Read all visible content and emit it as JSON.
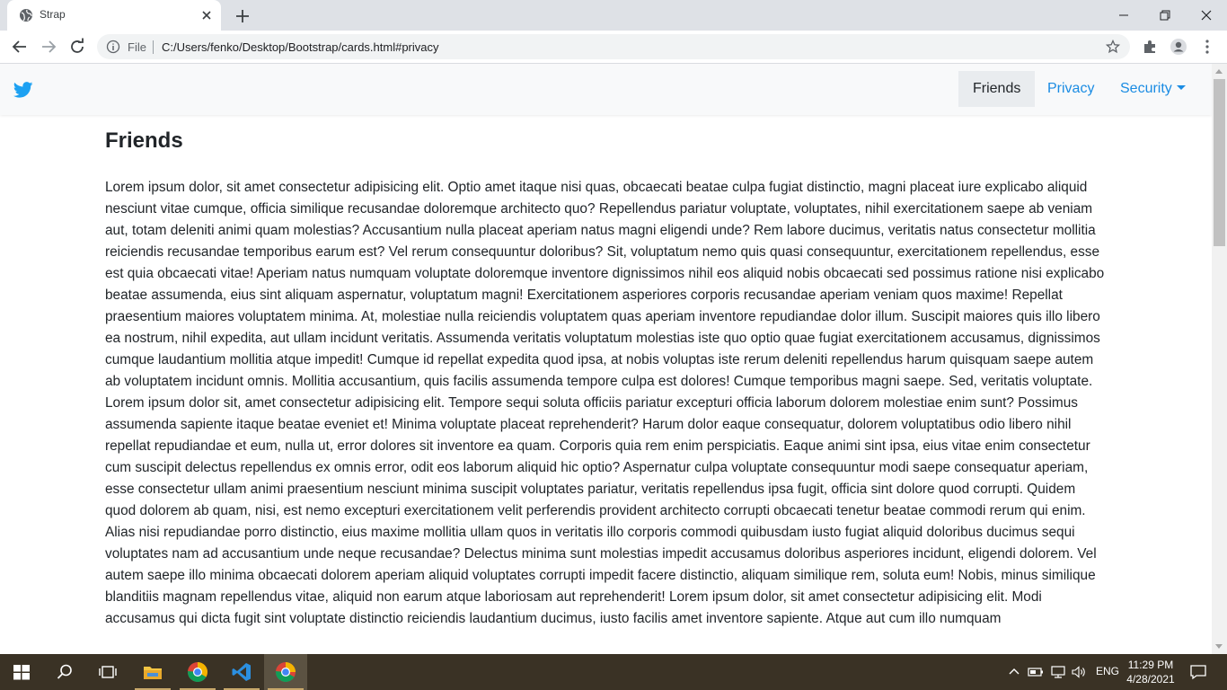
{
  "browser": {
    "tab_title": "Strap",
    "address_scheme": "File",
    "address_url": "C:/Users/fenko/Desktop/Bootstrap/cards.html#privacy"
  },
  "page": {
    "nav": {
      "items": [
        {
          "label": "Friends",
          "active": true
        },
        {
          "label": "Privacy",
          "active": false
        },
        {
          "label": "Security",
          "active": false,
          "dropdown": true
        }
      ]
    },
    "heading": "Friends",
    "body_text": "Lorem ipsum dolor, sit amet consectetur adipisicing elit. Optio amet itaque nisi quas, obcaecati beatae culpa fugiat distinctio, magni placeat iure explicabo aliquid nesciunt vitae cumque, officia similique recusandae doloremque architecto quo? Repellendus pariatur voluptate, voluptates, nihil exercitationem saepe ab veniam aut, totam deleniti animi quam molestias? Accusantium nulla placeat aperiam natus magni eligendi unde? Rem labore ducimus, veritatis natus consectetur mollitia reiciendis recusandae temporibus earum est? Vel rerum consequuntur doloribus? Sit, voluptatum nemo quis quasi consequuntur, exercitationem repellendus, esse est quia obcaecati vitae! Aperiam natus numquam voluptate doloremque inventore dignissimos nihil eos aliquid nobis obcaecati sed possimus ratione nisi explicabo beatae assumenda, eius sint aliquam aspernatur, voluptatum magni! Exercitationem asperiores corporis recusandae aperiam veniam quos maxime! Repellat praesentium maiores voluptatem minima. At, molestiae nulla reiciendis voluptatem quas aperiam inventore repudiandae dolor illum. Suscipit maiores quis illo libero ea nostrum, nihil expedita, aut ullam incidunt veritatis. Assumenda veritatis voluptatum molestias iste quo optio quae fugiat exercitationem accusamus, dignissimos cumque laudantium mollitia atque impedit! Cumque id repellat expedita quod ipsa, at nobis voluptas iste rerum deleniti repellendus harum quisquam saepe autem ab voluptatem incidunt omnis. Mollitia accusantium, quis facilis assumenda tempore culpa est dolores! Cumque temporibus magni saepe. Sed, veritatis voluptate. Lorem ipsum dolor sit, amet consectetur adipisicing elit. Tempore sequi soluta officiis pariatur excepturi officia laborum dolorem molestiae enim sunt? Possimus assumenda sapiente itaque beatae eveniet et! Minima voluptate placeat reprehenderit? Harum dolor eaque consequatur, dolorem voluptatibus odio libero nihil repellat repudiandae et eum, nulla ut, error dolores sit inventore ea quam. Corporis quia rem enim perspiciatis. Eaque animi sint ipsa, eius vitae enim consectetur cum suscipit delectus repellendus ex omnis error, odit eos laborum aliquid hic optio? Aspernatur culpa voluptate consequuntur modi saepe consequatur aperiam, esse consectetur ullam animi praesentium nesciunt minima suscipit voluptates pariatur, veritatis repellendus ipsa fugit, officia sint dolore quod corrupti. Quidem quod dolorem ab quam, nisi, est nemo excepturi exercitationem velit perferendis provident architecto corrupti obcaecati tenetur beatae commodi rerum qui enim. Alias nisi repudiandae porro distinctio, eius maxime mollitia ullam quos in veritatis illo corporis commodi quibusdam iusto fugiat aliquid doloribus ducimus sequi voluptates nam ad accusantium unde neque recusandae? Delectus minima sunt molestias impedit accusamus doloribus asperiores incidunt, eligendi dolorem. Vel autem saepe illo minima obcaecati dolorem aperiam aliquid voluptates corrupti impedit facere distinctio, aliquam similique rem, soluta eum! Nobis, minus similique blanditiis magnam repellendus vitae, aliquid non earum atque laboriosam aut reprehenderit! Lorem ipsum dolor, sit amet consectetur adipisicing elit. Modi accusamus qui dicta fugit sint voluptate distinctio reiciendis laudantium ducimus, iusto facilis amet inventore sapiente. Atque aut cum illo numquam"
  },
  "taskbar": {
    "language": "ENG",
    "time": "11:29 PM",
    "date": "4/28/2021"
  },
  "colors": {
    "link": "#1b8ce3",
    "twitter": "#1da1f2",
    "navbar_bg": "#f8f9fa",
    "active_nav_bg": "#e9ecef",
    "taskbar_bg": "#3a3225"
  },
  "icons": {
    "brand": "twitter-bird-icon",
    "tab_favicon": "globe-icon"
  }
}
